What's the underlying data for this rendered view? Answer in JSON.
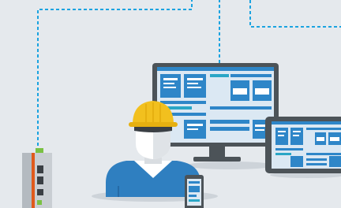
{
  "scene": {
    "background": "#e5e9ed",
    "connector_color": "#1aa3e0",
    "screen_blue": "#2e86c8",
    "light_panel": "#dbe8f3",
    "teal_accent": "#2aa6c6",
    "device_frame": "#4c5358",
    "helmet_yellow": "#f2c01e",
    "shirt_blue": "#2f7fc0",
    "gateway_orange": "#e05a1c"
  },
  "icons": {
    "worker": "engineer-with-hard-hat-icon",
    "monitor": "desktop-monitor-icon",
    "tablet": "tablet-icon",
    "phone": "smartphone-icon",
    "gateway": "industrial-gateway-device-icon"
  }
}
